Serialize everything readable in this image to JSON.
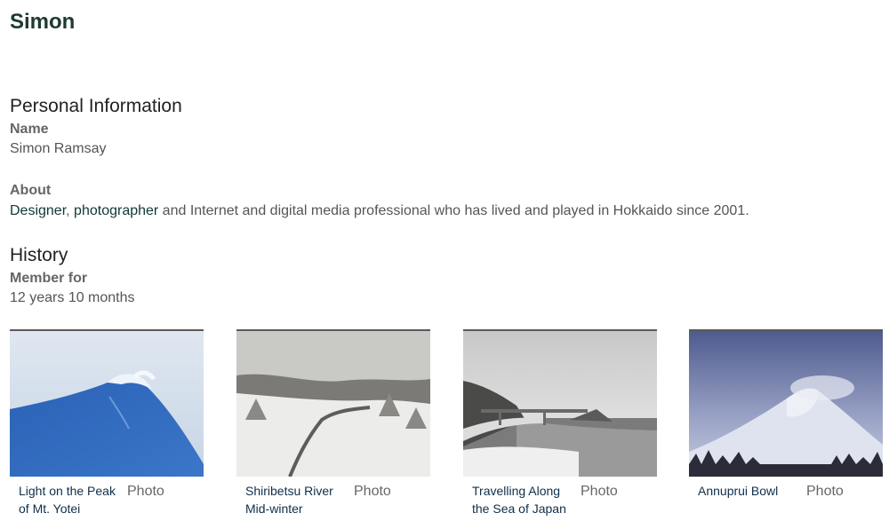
{
  "profile": {
    "name": "Simon"
  },
  "personal": {
    "heading": "Personal Information",
    "name_label": "Name",
    "name_value": "Simon Ramsay",
    "about_label": "About",
    "about_link1": "Designer",
    "about_sep": ", ",
    "about_link2": "photographer",
    "about_rest": " and Internet and digital media professional who has lived and played in Hokkaido since 2001."
  },
  "history": {
    "heading": "History",
    "member_label": "Member for",
    "member_value": "12 years 10 months"
  },
  "photos": [
    {
      "line1": "Light on the Peak",
      "line2": "of Mt. Yotei",
      "type": "Photo"
    },
    {
      "line1": "Shiribetsu River",
      "line2": "Mid-winter",
      "type": "Photo"
    },
    {
      "line1": "Travelling Along",
      "line2": "the Sea of Japan",
      "type": "Photo"
    },
    {
      "line1": "Annuprui Bowl",
      "line2": "",
      "type": "Photo"
    }
  ]
}
